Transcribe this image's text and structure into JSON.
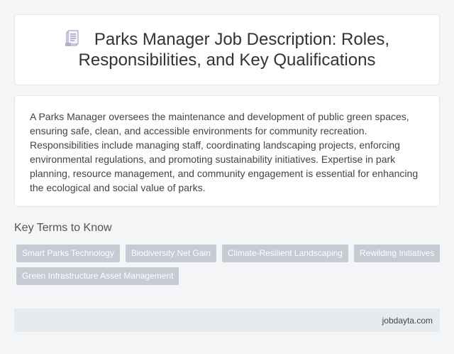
{
  "header": {
    "icon": "document-icon",
    "title": "Parks Manager Job Description: Roles, Responsibilities, and Key Qualifications"
  },
  "summary": {
    "text": "A Parks Manager oversees the maintenance and development of public green spaces, ensuring safe, clean, and accessible environments for community recreation. Responsibilities include managing staff, coordinating landscaping projects, enforcing environmental regulations, and promoting sustainability initiatives. Expertise in park planning, resource management, and community engagement is essential for enhancing the ecological and social value of parks."
  },
  "key_terms": {
    "heading": "Key Terms to Know",
    "tags": [
      "Smart Parks Technology",
      "Biodiversity Net Gain",
      "Climate-Resilient Landscaping",
      "Rewilding Initiatives",
      "Green Infrastructure Asset Management"
    ]
  },
  "footer": {
    "site": "jobdayta.com"
  },
  "colors": {
    "tag_background": "#c5cad3",
    "page_background": "#f4f5f7",
    "footer_background": "#e8ebed"
  }
}
